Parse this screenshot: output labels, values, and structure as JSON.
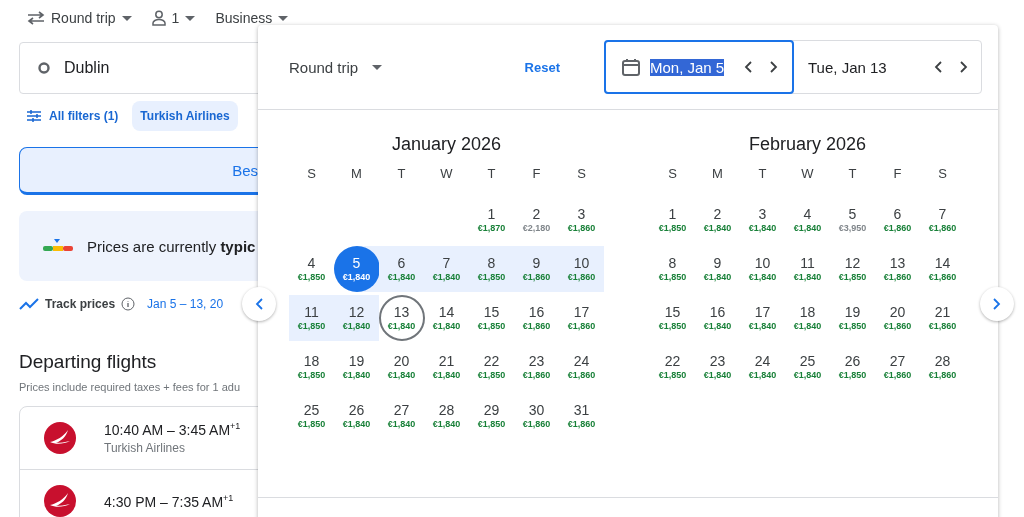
{
  "top_bar": {
    "trip_type": "Round trip",
    "passengers": "1",
    "cabin": "Business"
  },
  "origin": {
    "value": "Dublin"
  },
  "filters": [
    {
      "label": "All filters (1)",
      "kind": "filters"
    },
    {
      "label": "Turkish Airlines",
      "kind": "chip"
    }
  ],
  "sort_tab": {
    "label": "Bes",
    "selected": true
  },
  "price_insight": {
    "text": "Prices are currently **typic**"
  },
  "track": {
    "label": "Track prices",
    "dates": "Jan 5 – 13, 20"
  },
  "departing": {
    "title": "Departing flights",
    "subtitle": "Prices include required taxes + fees for 1 adu",
    "flights": [
      {
        "times": "10:40 AM – 3:45 AM$^{+1}$",
        "airline": "Turkish Airlines"
      },
      {
        "times": "4:30 PM – 7:35 AM$^{+1}$"
      }
    ]
  },
  "date_picker": {
    "trip_type": "Round trip",
    "reset": "Reset",
    "departure": {
      "value": "Mon, Jan 5",
      "selected": true
    },
    "return": {
      "value": "Tue, Jan 13",
      "selected": false
    },
    "months": [
      {
        "title": "January 2026",
        "weekdays": [
          "S",
          "M",
          "T",
          "W",
          "T",
          "F",
          "S"
        ],
        "days": [
          {
            "kind": "empty"
          },
          {
            "kind": "empty"
          },
          {
            "kind": "empty"
          },
          {
            "kind": "empty"
          },
          {
            "day": "1",
            "price": "€1,870",
            "high": false,
            "kind": "plain"
          },
          {
            "day": "2",
            "price": "€2,180",
            "high": true,
            "kind": "plain"
          },
          {
            "day": "3",
            "price": "€1,860",
            "high": false,
            "kind": "plain"
          },
          {
            "day": "4",
            "price": "€1,850",
            "high": false,
            "kind": "plain"
          },
          {
            "day": "5",
            "price": "€1,840",
            "high": false,
            "kind": "start"
          },
          {
            "day": "6",
            "price": "€1,840",
            "high": false,
            "kind": "in_range"
          },
          {
            "day": "7",
            "price": "€1,840",
            "high": false,
            "kind": "in_range"
          },
          {
            "day": "8",
            "price": "€1,850",
            "high": false,
            "kind": "in_range"
          },
          {
            "day": "9",
            "price": "€1,860",
            "high": false,
            "kind": "in_range"
          },
          {
            "day": "10",
            "price": "€1,860",
            "high": false,
            "kind": "in_range"
          },
          {
            "day": "11",
            "price": "€1,850",
            "high": false,
            "kind": "in_range"
          },
          {
            "day": "12",
            "price": "€1,840",
            "high": false,
            "kind": "in_range"
          },
          {
            "day": "13",
            "price": "€1,840",
            "high": false,
            "kind": "end"
          },
          {
            "day": "14",
            "price": "€1,840",
            "high": false,
            "kind": "plain"
          },
          {
            "day": "15",
            "price": "€1,850",
            "high": false,
            "kind": "plain"
          },
          {
            "day": "16",
            "price": "€1,860",
            "high": false,
            "kind": "plain"
          },
          {
            "day": "17",
            "price": "€1,860",
            "high": false,
            "kind": "plain"
          },
          {
            "day": "18",
            "price": "€1,850",
            "high": false,
            "kind": "plain"
          },
          {
            "day": "19",
            "price": "€1,840",
            "high": false,
            "kind": "plain"
          },
          {
            "day": "20",
            "price": "€1,840",
            "high": false,
            "kind": "plain"
          },
          {
            "day": "21",
            "price": "€1,840",
            "high": false,
            "kind": "plain"
          },
          {
            "day": "22",
            "price": "€1,850",
            "high": false,
            "kind": "plain"
          },
          {
            "day": "23",
            "price": "€1,860",
            "high": false,
            "kind": "plain"
          },
          {
            "day": "24",
            "price": "€1,860",
            "high": false,
            "kind": "plain"
          },
          {
            "day": "25",
            "price": "€1,850",
            "high": false,
            "kind": "plain"
          },
          {
            "day": "26",
            "price": "€1,840",
            "high": false,
            "kind": "plain"
          },
          {
            "day": "27",
            "price": "€1,840",
            "high": false,
            "kind": "plain"
          },
          {
            "day": "28",
            "price": "€1,840",
            "high": false,
            "kind": "plain"
          },
          {
            "day": "29",
            "price": "€1,850",
            "high": false,
            "kind": "plain"
          },
          {
            "day": "30",
            "price": "€1,860",
            "high": false,
            "kind": "plain"
          },
          {
            "day": "31",
            "price": "€1,860",
            "high": false,
            "kind": "plain"
          }
        ]
      },
      {
        "title": "February 2026",
        "weekdays": [
          "S",
          "M",
          "T",
          "W",
          "T",
          "F",
          "S"
        ],
        "days": [
          {
            "day": "1",
            "price": "€1,850",
            "high": false,
            "kind": "plain"
          },
          {
            "day": "2",
            "price": "€1,840",
            "high": false,
            "kind": "plain"
          },
          {
            "day": "3",
            "price": "€1,840",
            "high": false,
            "kind": "plain"
          },
          {
            "day": "4",
            "price": "€1,840",
            "high": false,
            "kind": "plain"
          },
          {
            "day": "5",
            "price": "€3,950",
            "high": true,
            "kind": "plain"
          },
          {
            "day": "6",
            "price": "€1,860",
            "high": false,
            "kind": "plain"
          },
          {
            "day": "7",
            "price": "€1,860",
            "high": false,
            "kind": "plain"
          },
          {
            "day": "8",
            "price": "€1,850",
            "high": false,
            "kind": "plain"
          },
          {
            "day": "9",
            "price": "€1,840",
            "high": false,
            "kind": "plain"
          },
          {
            "day": "10",
            "price": "€1,840",
            "high": false,
            "kind": "plain"
          },
          {
            "day": "11",
            "price": "€1,840",
            "high": false,
            "kind": "plain"
          },
          {
            "day": "12",
            "price": "€1,850",
            "high": false,
            "kind": "plain"
          },
          {
            "day": "13",
            "price": "€1,860",
            "high": false,
            "kind": "plain"
          },
          {
            "day": "14",
            "price": "€1,860",
            "high": false,
            "kind": "plain"
          },
          {
            "day": "15",
            "price": "€1,850",
            "high": false,
            "kind": "plain"
          },
          {
            "day": "16",
            "price": "€1,840",
            "high": false,
            "kind": "plain"
          },
          {
            "day": "17",
            "price": "€1,840",
            "high": false,
            "kind": "plain"
          },
          {
            "day": "18",
            "price": "€1,840",
            "high": false,
            "kind": "plain"
          },
          {
            "day": "19",
            "price": "€1,850",
            "high": false,
            "kind": "plain"
          },
          {
            "day": "20",
            "price": "€1,860",
            "high": false,
            "kind": "plain"
          },
          {
            "day": "21",
            "price": "€1,860",
            "high": false,
            "kind": "plain"
          },
          {
            "day": "22",
            "price": "€1,850",
            "high": false,
            "kind": "plain"
          },
          {
            "day": "23",
            "price": "€1,840",
            "high": false,
            "kind": "plain"
          },
          {
            "day": "24",
            "price": "€1,840",
            "high": false,
            "kind": "plain"
          },
          {
            "day": "25",
            "price": "€1,840",
            "high": false,
            "kind": "plain"
          },
          {
            "day": "26",
            "price": "€1,850",
            "high": false,
            "kind": "plain"
          },
          {
            "day": "27",
            "price": "€1,860",
            "high": false,
            "kind": "plain"
          },
          {
            "day": "28",
            "price": "€1,860",
            "high": false,
            "kind": "plain"
          }
        ]
      }
    ]
  }
}
